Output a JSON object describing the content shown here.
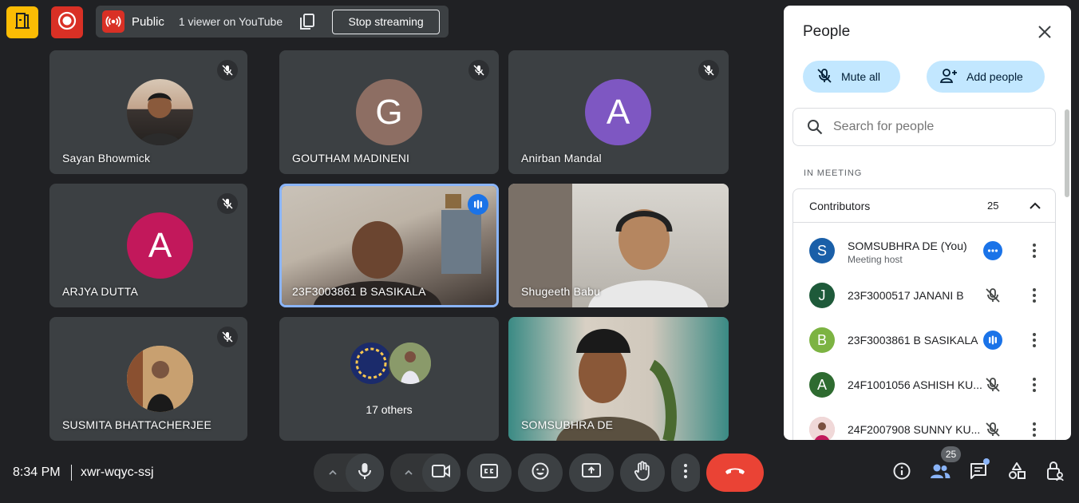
{
  "topbar": {
    "stream_visibility": "Public",
    "stream_viewers": "1 viewer on YouTube",
    "stop_streaming_label": "Stop streaming"
  },
  "tiles": [
    {
      "name": "Sayan Bhowmick",
      "avatar_type": "photo",
      "muted": true
    },
    {
      "name": "GOUTHAM MADINENI",
      "avatar_type": "letter",
      "letter": "G",
      "color": "#8d6e63",
      "muted": true
    },
    {
      "name": "Anirban Mandal",
      "avatar_type": "letter",
      "letter": "A",
      "color": "#7e57c2",
      "muted": true
    },
    {
      "name": "ARJYA DUTTA",
      "avatar_type": "letter",
      "letter": "A",
      "color": "#c2185b",
      "muted": true
    },
    {
      "name": "23F3003861 B SASIKALA",
      "avatar_type": "video",
      "speaking": true
    },
    {
      "name": "Shugeeth Babu",
      "avatar_type": "video"
    },
    {
      "name": "SUSMITA BHATTACHERJEE",
      "avatar_type": "photo",
      "muted": true
    },
    {
      "name": "17 others",
      "avatar_type": "group"
    },
    {
      "name": "SOMSUBHRA DE",
      "avatar_type": "video"
    }
  ],
  "people_panel": {
    "title": "People",
    "mute_all_label": "Mute all",
    "add_people_label": "Add people",
    "search_placeholder": "Search for people",
    "section_label": "IN MEETING",
    "contributors_label": "Contributors",
    "contributors_count": "25",
    "people": [
      {
        "name": "SOMSUBHRA DE (You)",
        "subtitle": "Meeting host",
        "letter": "S",
        "color": "#1a5fa8",
        "status": "more"
      },
      {
        "name": "23F3000517 JANANI B",
        "letter": "J",
        "color": "#1e5a3a",
        "status": "mic-off"
      },
      {
        "name": "23F3003861 B SASIKALA",
        "letter": "B",
        "color": "#7cb342",
        "status": "speaking"
      },
      {
        "name": "24F1001056 ASHISH KU...",
        "letter": "A",
        "color": "#2e6b30",
        "status": "mic-off"
      },
      {
        "name": "24F2007908 SUNNY KU...",
        "letter": "",
        "color": "#e8b4b8",
        "status": "mic-off"
      }
    ]
  },
  "bottombar": {
    "time": "8:34 PM",
    "meeting_code": "xwr-wqyc-ssj",
    "people_count": "25"
  },
  "colors": {
    "background": "#202124",
    "tile": "#3c4043",
    "end_call": "#ea4335",
    "accent": "#1a73e8",
    "chip": "#c2e7ff"
  }
}
